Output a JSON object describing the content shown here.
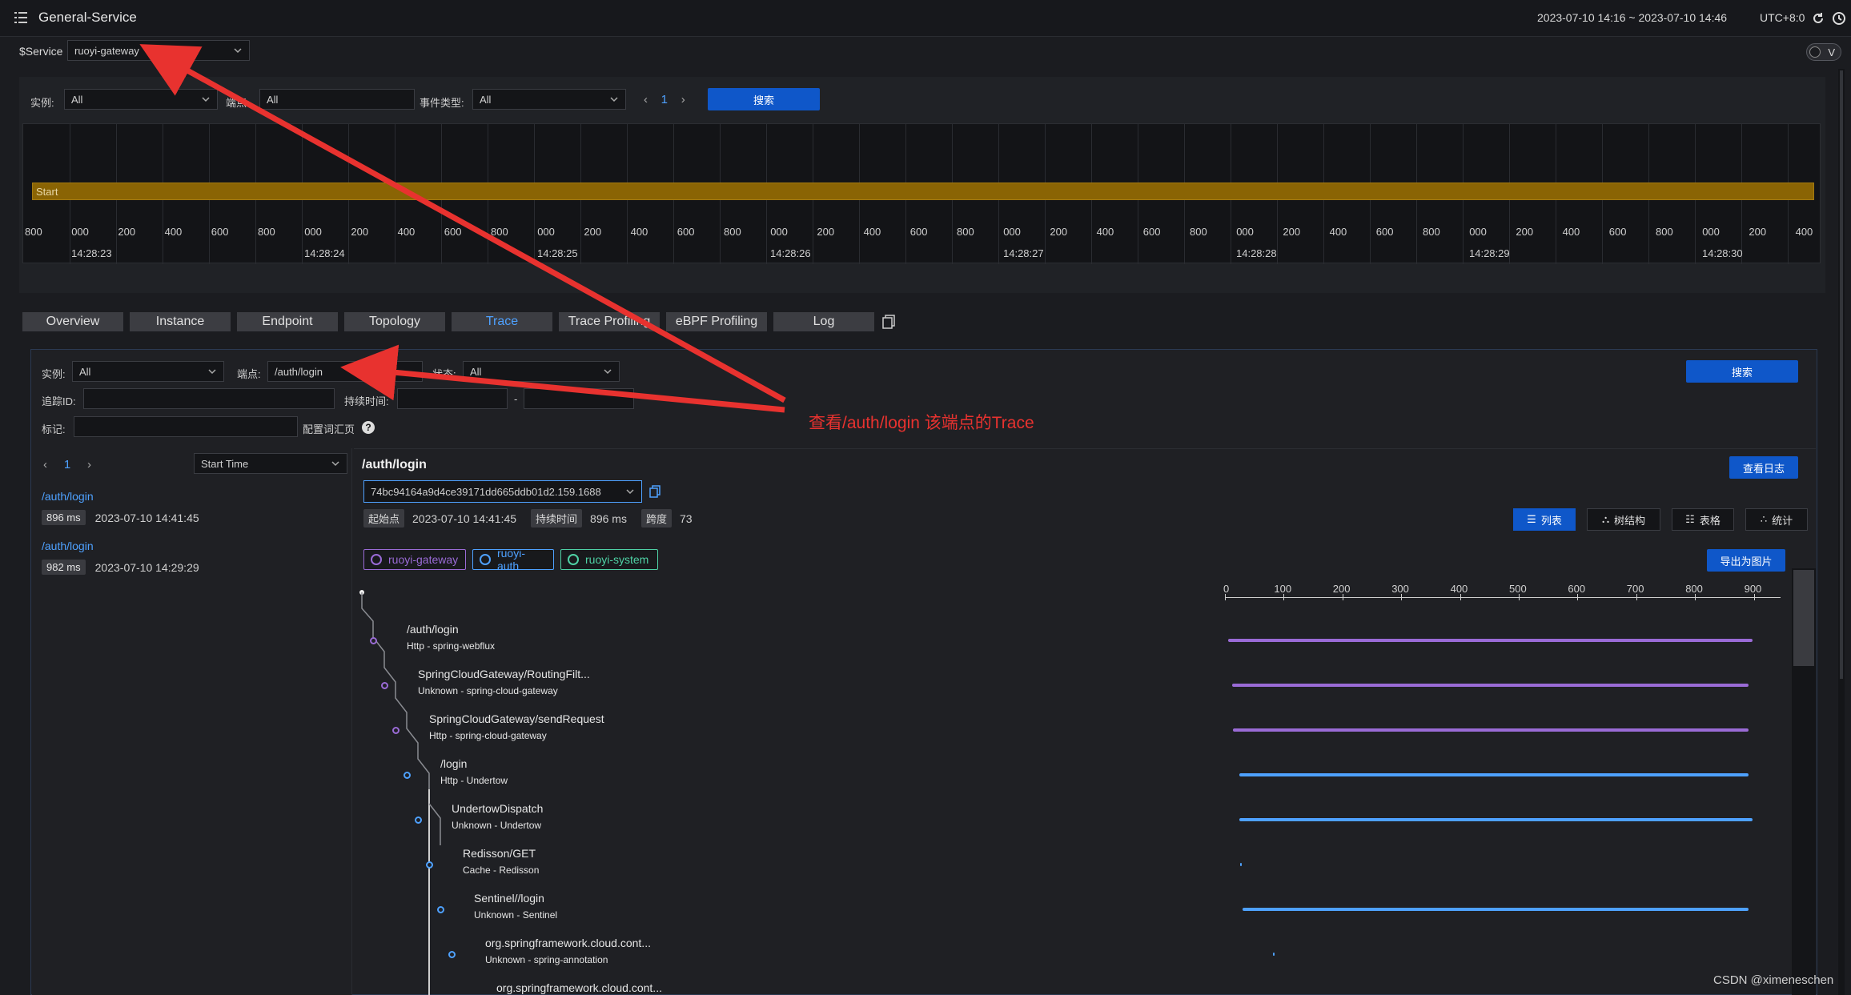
{
  "header": {
    "title": "General-Service",
    "time_range": "2023-07-10 14:16 ~ 2023-07-10 14:46",
    "timezone": "UTC+8:0"
  },
  "service": {
    "label": "$Service",
    "value": "ruoyi-gateway",
    "toggle_label": "V"
  },
  "events": {
    "instance_label": "实例:",
    "instance_value": "All",
    "endpoint_label": "端点:",
    "endpoint_value": "All",
    "event_type_label": "事件类型:",
    "event_type_value": "All",
    "page": "1",
    "search_label": "搜索",
    "start_label": "Start",
    "ticks": [
      "800",
      "000",
      "200",
      "400",
      "600",
      "800",
      "000",
      "200",
      "400",
      "600",
      "800",
      "000",
      "200",
      "400",
      "600",
      "800",
      "000",
      "200",
      "400",
      "600",
      "800",
      "000",
      "200",
      "400",
      "600",
      "800",
      "000",
      "200",
      "400",
      "600",
      "800",
      "000",
      "200",
      "400",
      "600",
      "800",
      "000",
      "200",
      "400"
    ],
    "time_labels": [
      "14:28:23",
      "14:28:24",
      "14:28:25",
      "14:28:26",
      "14:28:27",
      "14:28:28",
      "14:28:29",
      "14:28:30"
    ]
  },
  "tabs": [
    "Overview",
    "Instance",
    "Endpoint",
    "Topology",
    "Trace",
    "Trace Profiling",
    "eBPF Profiling",
    "Log"
  ],
  "active_tab": "Trace",
  "trace_filters": {
    "instance_label": "实例:",
    "instance_value": "All",
    "endpoint_label": "端点:",
    "endpoint_value": "/auth/login",
    "status_label": "状态:",
    "status_value": "All",
    "search_label": "搜索",
    "trace_id_label": "追踪ID:",
    "duration_label": "持续时间:",
    "duration_sep": "-",
    "tags_label": "标记:",
    "config_label": "配置词汇页",
    "help": "?"
  },
  "trace_list": {
    "page": "1",
    "sort_value": "Start Time",
    "items": [
      {
        "endpoint": "/auth/login",
        "duration": "896 ms",
        "start": "2023-07-10 14:41:45"
      },
      {
        "endpoint": "/auth/login",
        "duration": "982 ms",
        "start": "2023-07-10 14:29:29"
      }
    ]
  },
  "trace_detail": {
    "title": "/auth/login",
    "view_logs_label": "查看日志",
    "trace_id": "74bc94164a9d4ce39171dd665ddb01d2.159.1688",
    "start_label": "起始点",
    "start_value": "2023-07-10 14:41:45",
    "duration_label": "持续时间",
    "duration_value": "896 ms",
    "spans_label": "跨度",
    "spans_value": "73",
    "views": [
      "列表",
      "树结构",
      "表格",
      "统计"
    ],
    "active_view": "列表",
    "export_label": "导出为图片",
    "services": [
      {
        "name": "ruoyi-gateway",
        "color": "#9a6bd6"
      },
      {
        "name": "ruoyi-auth",
        "color": "#4ea1ff"
      },
      {
        "name": "ruoyi-system",
        "color": "#4fd1a5"
      }
    ],
    "axis": [
      "0",
      "100",
      "200",
      "300",
      "400",
      "500",
      "600",
      "700",
      "800",
      "900"
    ],
    "spans": [
      {
        "name": "/auth/login",
        "sub": "Http - spring-webflux",
        "start": 5,
        "end": 900,
        "color": "#9a6bd6"
      },
      {
        "name": "SpringCloudGateway/RoutingFilt...",
        "sub": "Unknown - spring-cloud-gateway",
        "start": 12,
        "end": 892,
        "color": "#9a6bd6"
      },
      {
        "name": "SpringCloudGateway/sendRequest",
        "sub": "Http - spring-cloud-gateway",
        "start": 14,
        "end": 892,
        "color": "#9a6bd6"
      },
      {
        "name": "/login",
        "sub": "Http - Undertow",
        "start": 24,
        "end": 892,
        "color": "#4ea1ff"
      },
      {
        "name": "UndertowDispatch",
        "sub": "Unknown - Undertow",
        "start": 24,
        "end": 900,
        "color": "#4ea1ff"
      },
      {
        "name": "Redisson/GET",
        "sub": "Cache - Redisson",
        "start": 26,
        "end": 27,
        "color": "#4ea1ff"
      },
      {
        "name": "Sentinel//login",
        "sub": "Unknown - Sentinel",
        "start": 30,
        "end": 892,
        "color": "#4ea1ff"
      },
      {
        "name": "org.springframework.cloud.cont...",
        "sub": "Unknown - spring-annotation",
        "start": 82,
        "end": 83,
        "color": "#4ea1ff"
      },
      {
        "name": "org.springframework.cloud.cont...",
        "sub": "",
        "start": 0,
        "end": 0,
        "color": "#4ea1ff"
      }
    ]
  },
  "annotation": "查看/auth/login 该端点的Trace",
  "watermark": "CSDN @ximeneschen",
  "colors": {
    "accent": "#0f57c9",
    "annotation": "#e8322f",
    "start_bar": "#8a6404"
  }
}
